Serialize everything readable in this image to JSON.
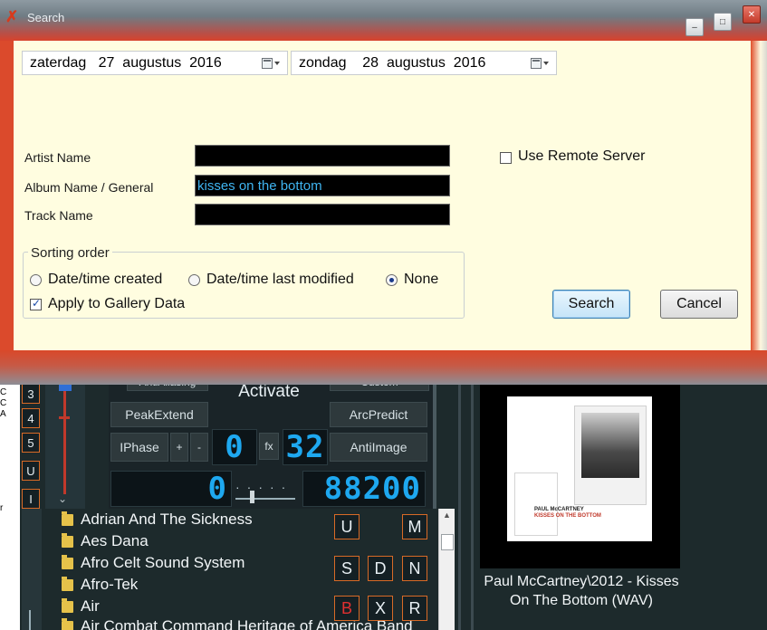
{
  "dialog": {
    "title": "Search",
    "date_from": "zaterdag   27  augustus  2016",
    "date_to": "zondag    28  augustus  2016",
    "artist_label": "Artist Name",
    "artist_value": "",
    "album_label": "Album Name / General",
    "album_value": "kisses on the bottom",
    "track_label": "Track Name",
    "track_value": "",
    "remote_label": "Use Remote Server",
    "remote_checked": false,
    "sorting_title": "Sorting order",
    "sort_options": [
      "Date/time created",
      "Date/time last modified",
      "None"
    ],
    "sort_selected": "None",
    "gallery_label": "Apply to Gallery Data",
    "gallery_checked": true,
    "search_button": "Search",
    "cancel_button": "Cancel",
    "minimize_glyph": "–",
    "maximize_glyph": "□",
    "close_glyph": "✕"
  },
  "player": {
    "left_edge_text": [
      "C",
      "C",
      "A",
      "r"
    ],
    "number_buttons": [
      "3",
      "4",
      "5",
      "U",
      "I"
    ],
    "dsp_top_left": "AntiAliasing",
    "dsp_top_right": "Custom",
    "activate_label": "Activate",
    "peak_extend": "PeakExtend",
    "arc_predict": "ArcPredict",
    "iphase": "IPhase",
    "plus": "+",
    "minus": "-",
    "anti_image": "AntiImage",
    "lcd_small_left": "0",
    "fx_label": "fx",
    "lcd_small_right": "32",
    "lcd_left": "0",
    "lcd_right": "88200",
    "tree_items": [
      "Adrian And The Sickness",
      "Aes Dana",
      "Afro Celt Sound System",
      "Afro-Tek",
      "Air",
      "Air Combat Command Heritage of America Band"
    ],
    "letters_row1": [
      "U",
      "M"
    ],
    "letters_row2": [
      "S",
      "D",
      "N"
    ],
    "letters_row3": [
      "B",
      "X",
      "R"
    ],
    "album_caption_line1": "Paul McCartney\\2012 - Kisses",
    "album_caption_line2": "On The Bottom (WAV)",
    "art_text_artist": "PAUL McCARTNEY",
    "art_text_title": "KISSES ON THE BOTTOM"
  },
  "colors": {
    "accent_orange": "#d86a26",
    "lcd_blue": "#1ea8f0",
    "dialog_bg": "#fffde0",
    "frame_red": "#db4a2c"
  },
  "icons": {
    "app": "tools-icon",
    "calendar": "calendar-dropdown-icon",
    "folder": "folder-icon"
  }
}
